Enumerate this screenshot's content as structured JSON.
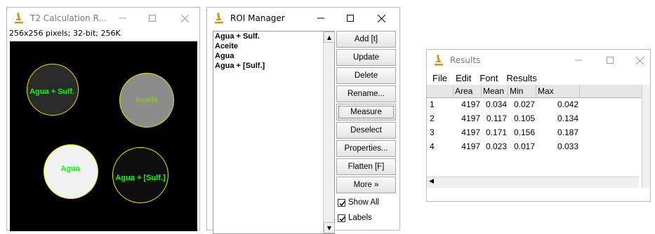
{
  "t2_window": {
    "title": "T2 Calculation R...",
    "info": "256x256 pixels; 32-bit; 256K",
    "rois": [
      {
        "label": "Agua + Sulf.",
        "fill": "#2a2a2a"
      },
      {
        "label": "Aceite",
        "fill": "#8c8c8c"
      },
      {
        "label": "Agua",
        "fill": "#f2f2f2"
      },
      {
        "label": "Agua + [Sulf.]",
        "fill": "#0e0e0e"
      }
    ]
  },
  "roi_manager": {
    "title": "ROI Manager",
    "list": [
      "Agua + Sulf.",
      "Aceite",
      "Agua",
      "Agua + [Sulf.]"
    ],
    "buttons": [
      "Add [t]",
      "Update",
      "Delete",
      "Rename...",
      "Measure",
      "Deselect",
      "Properties...",
      "Flatten [F]",
      "More »"
    ],
    "checkboxes": [
      {
        "label": "Show All",
        "checked": true
      },
      {
        "label": "Labels",
        "checked": true
      }
    ]
  },
  "results_window": {
    "title": "Results",
    "menu": [
      "File",
      "Edit",
      "Font",
      "Results"
    ],
    "columns": [
      "",
      "Area",
      "Mean",
      "Min",
      "Max"
    ],
    "rows": [
      [
        "1",
        "4197",
        "0.034",
        "0.027",
        "0.042"
      ],
      [
        "2",
        "4197",
        "0.117",
        "0.105",
        "0.134"
      ],
      [
        "3",
        "4197",
        "0.171",
        "0.156",
        "0.187"
      ],
      [
        "4",
        "4197",
        "0.023",
        "0.017",
        "0.033"
      ]
    ]
  },
  "icons": {
    "app": "imagej-microscope-icon",
    "minimize": "minimize-icon",
    "maximize": "maximize-icon",
    "close": "close-icon"
  }
}
